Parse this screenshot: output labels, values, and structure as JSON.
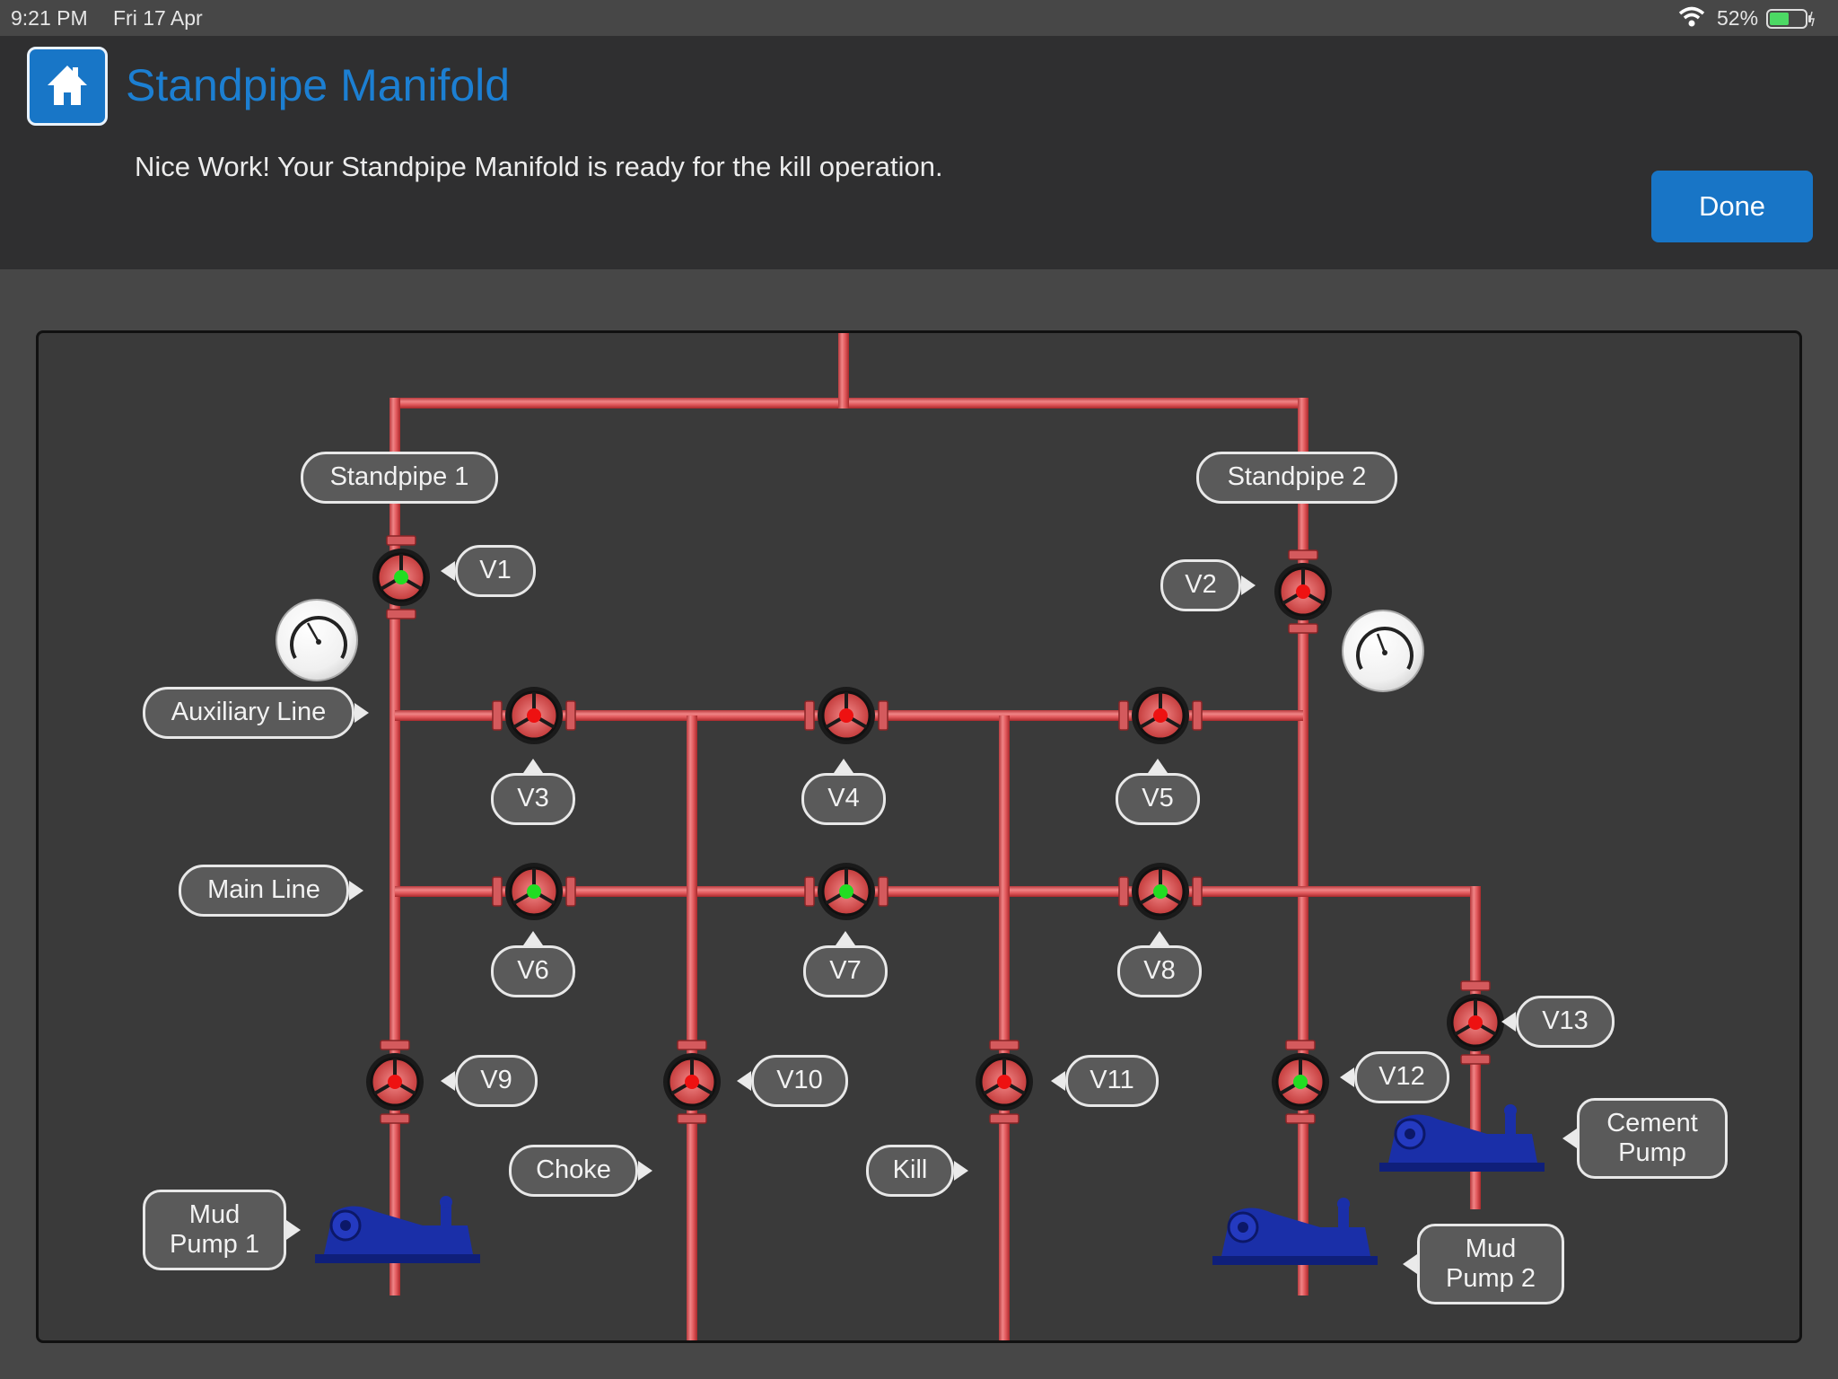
{
  "status_bar": {
    "time": "9:21 PM",
    "date": "Fri 17 Apr",
    "battery": "52%"
  },
  "header": {
    "title": "Standpipe Manifold",
    "message": "Nice Work! Your Standpipe Manifold is ready for the kill operation.",
    "done_label": "Done",
    "accent_color": "#1876c7"
  },
  "labels": {
    "standpipe1": "Standpipe 1",
    "standpipe2": "Standpipe 2",
    "auxiliary_line": "Auxiliary Line",
    "main_line": "Main Line",
    "choke": "Choke",
    "kill": "Kill",
    "mud_pump1_l1": "Mud",
    "mud_pump1_l2": "Pump 1",
    "mud_pump2_l1": "Mud",
    "mud_pump2_l2": "Pump 2",
    "cement_pump_l1": "Cement",
    "cement_pump_l2": "Pump"
  },
  "valves": [
    {
      "id": "V1",
      "state": "open"
    },
    {
      "id": "V2",
      "state": "closed"
    },
    {
      "id": "V3",
      "state": "closed"
    },
    {
      "id": "V4",
      "state": "closed"
    },
    {
      "id": "V5",
      "state": "closed"
    },
    {
      "id": "V6",
      "state": "open"
    },
    {
      "id": "V7",
      "state": "open"
    },
    {
      "id": "V8",
      "state": "open"
    },
    {
      "id": "V9",
      "state": "closed"
    },
    {
      "id": "V10",
      "state": "closed"
    },
    {
      "id": "V11",
      "state": "closed"
    },
    {
      "id": "V12",
      "state": "open"
    },
    {
      "id": "V13",
      "state": "closed"
    }
  ],
  "colors": {
    "pipe": "#e0575a",
    "open": "#22dd22",
    "closed": "#ee1111",
    "pump": "#1a2fa8"
  },
  "icons": {
    "home": "home-icon",
    "wifi": "wifi-icon",
    "battery": "battery-icon",
    "gauge": "pressure-gauge-icon",
    "pump": "pump-icon"
  }
}
